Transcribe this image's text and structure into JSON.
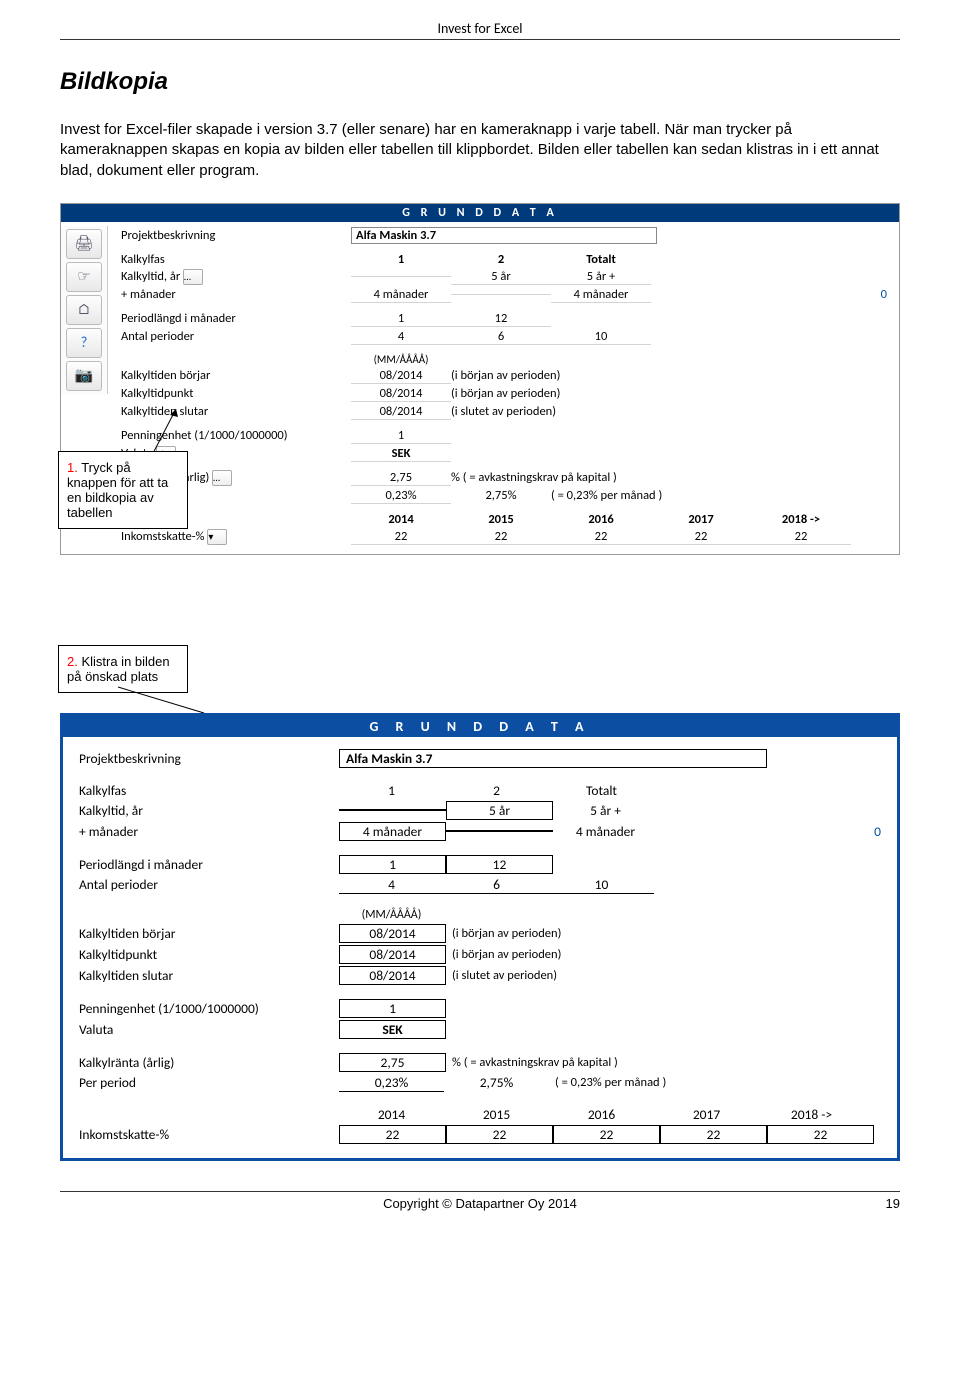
{
  "header": {
    "product": "Invest for Excel"
  },
  "doc": {
    "heading": "Bildkopia",
    "paragraph": "Invest for Excel-filer skapade i version 3.7 (eller senare) har en kameraknapp i varje tabell. När man trycker på kameraknappen skapas en kopia av bilden eller tabellen till klippbordet. Bilden eller tabellen kan sedan klistras in i ett annat blad, dokument eller program."
  },
  "callouts": {
    "one_num": "1.",
    "one_txt": " Tryck på knappen för att ta en bildkopia av tabellen",
    "two_num": "2.",
    "two_txt": " Klistra in bilden på önskad plats"
  },
  "ss": {
    "title": "G R U N D D A T A",
    "sidebar_icons": [
      "printer-icon",
      "hand-icon",
      "home-icon",
      "help-icon",
      "camera-icon"
    ],
    "rows": {
      "projbeskr_lbl": "Projektbeskrivning",
      "projbeskr_val": "Alfa Maskin 3.7",
      "kalkylfas_lbl": "Kalkylfas",
      "kalkylfas_c1": "1",
      "kalkylfas_c2": "2",
      "kalkylfas_tot": "Totalt",
      "kalkyltid_lbl": "Kalkyltid, år",
      "kalkyltid_c2": "5 år",
      "kalkyltid_tot": "5 år +",
      "manader_lbl": "+ månader",
      "manader_c1": "4 månader",
      "manader_tot": "4 månader",
      "manader_far": "0",
      "pl_lbl": "Periodlängd i månader",
      "pl_c1": "1",
      "pl_c2": "12",
      "ap_lbl": "Antal perioder",
      "ap_c1": "4",
      "ap_c2": "6",
      "ap_tot": "10",
      "mm_lbl": "(MM/ÅÅÅÅ)",
      "kb_lbl": "Kalkyltiden börjar",
      "kb_v": "08/2014",
      "kb_note": "(i början av perioden)",
      "kp_lbl": "Kalkyltidpunkt",
      "kp_v": "08/2014",
      "kp_note": "(i början av perioden)",
      "ks_lbl": "Kalkyltiden slutar",
      "ks_v": "08/2014",
      "ks_note": "(i slutet av perioden)",
      "pe_lbl": "Penningenhet (1/1000/1000000)",
      "pe_v": "1",
      "va_lbl": "Valuta",
      "va_v": "SEK",
      "kr_lbl": "Kalkylränta (årlig)",
      "kr_v": "2,75",
      "kr_note": "% ( = avkastningskrav på kapital )",
      "pp_lbl": "Per period",
      "pp_v": "0,23%",
      "pp_v2": "2,75%",
      "pp_note": "( = 0,23% per månad )",
      "years": [
        "2014",
        "2015",
        "2016",
        "2017",
        "2018 ->"
      ],
      "tax_lbl": "Inkomstskatte-%",
      "tax_vals": [
        "22",
        "22",
        "22",
        "22",
        "22"
      ]
    }
  },
  "paste": {
    "title": "G R U N D D A T A",
    "proj_lbl": "Projektbeskrivning",
    "proj_val": "Alfa Maskin 3.7",
    "kalkylfas_lbl": "Kalkylfas",
    "kf_c": [
      "1",
      "2",
      "Totalt"
    ],
    "kalkyltid_lbl": "Kalkyltid, år",
    "kt_c": [
      "",
      "5 år",
      "5 år +"
    ],
    "man_lbl": "+ månader",
    "man_c": [
      "4 månader",
      "",
      "4 månader"
    ],
    "man_far": "0",
    "pl_lbl": "Periodlängd i månader",
    "pl_c": [
      "1",
      "12"
    ],
    "ap_lbl": "Antal perioder",
    "ap_c": [
      "4",
      "6",
      "10"
    ],
    "mm": "(MM/ÅÅÅÅ)",
    "kb_lbl": "Kalkyltiden börjar",
    "kb_v": "08/2014",
    "kb_note": "(i början av perioden)",
    "kp_lbl": "Kalkyltidpunkt",
    "kp_v": "08/2014",
    "kp_note": "(i början av perioden)",
    "ks_lbl": "Kalkyltiden slutar",
    "ks_v": "08/2014",
    "ks_note": "(i slutet av perioden)",
    "pe_lbl": "Penningenhet (1/1000/1000000)",
    "pe_v": "1",
    "va_lbl": "Valuta",
    "va_v": "SEK",
    "kr_lbl": "Kalkylränta (årlig)",
    "kr_v": "2,75",
    "kr_note": "% ( = avkastningskrav på kapital )",
    "pp_lbl": "Per period",
    "pp_v": "0,23%",
    "pp_v2": "2,75%",
    "pp_note": "( = 0,23% per månad )",
    "years": [
      "2014",
      "2015",
      "2016",
      "2017",
      "2018 ->"
    ],
    "tax_lbl": "Inkomstskatte-%",
    "tax_vals": [
      "22",
      "22",
      "22",
      "22",
      "22"
    ]
  },
  "footer": {
    "copyright": "Copyright © Datapartner Oy 2014",
    "page": "19"
  }
}
